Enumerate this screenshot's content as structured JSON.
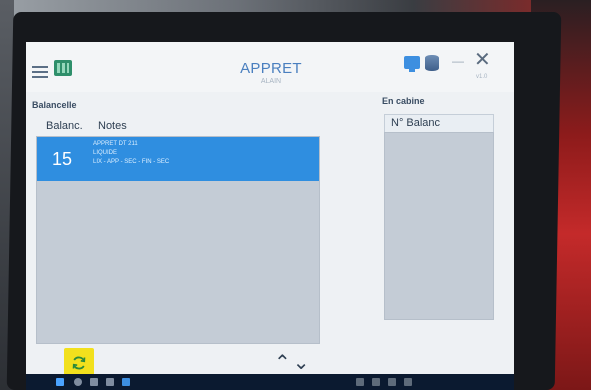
{
  "app": {
    "title": "APPRET",
    "subtitle": "ALAIN",
    "version": "v1.0"
  },
  "left_panel": {
    "section_title": "Balancelle",
    "columns": [
      "Balanc.",
      "Notes"
    ],
    "rows": [
      {
        "number": "15",
        "notes": [
          "APPRET DT 211",
          "LIQUIDE",
          "LIX - APP - SEC - FIN - SEC"
        ]
      }
    ]
  },
  "right_panel": {
    "section_title": "En cabine",
    "column": "N° Balanc"
  },
  "controls": {
    "up_arrow": "⌃",
    "down_arrow": "⌄"
  },
  "icons": {
    "menu": "hamburger-icon",
    "app": "grid-icon",
    "monitor": "monitor-icon",
    "database": "database-icon",
    "minimize": "minimize-icon",
    "close": "close-icon",
    "refresh": "refresh-icon"
  },
  "colors": {
    "accent": "#2f8ee0",
    "refresh_button": "#f2e01d",
    "list_bg": "#c4ccd6"
  }
}
